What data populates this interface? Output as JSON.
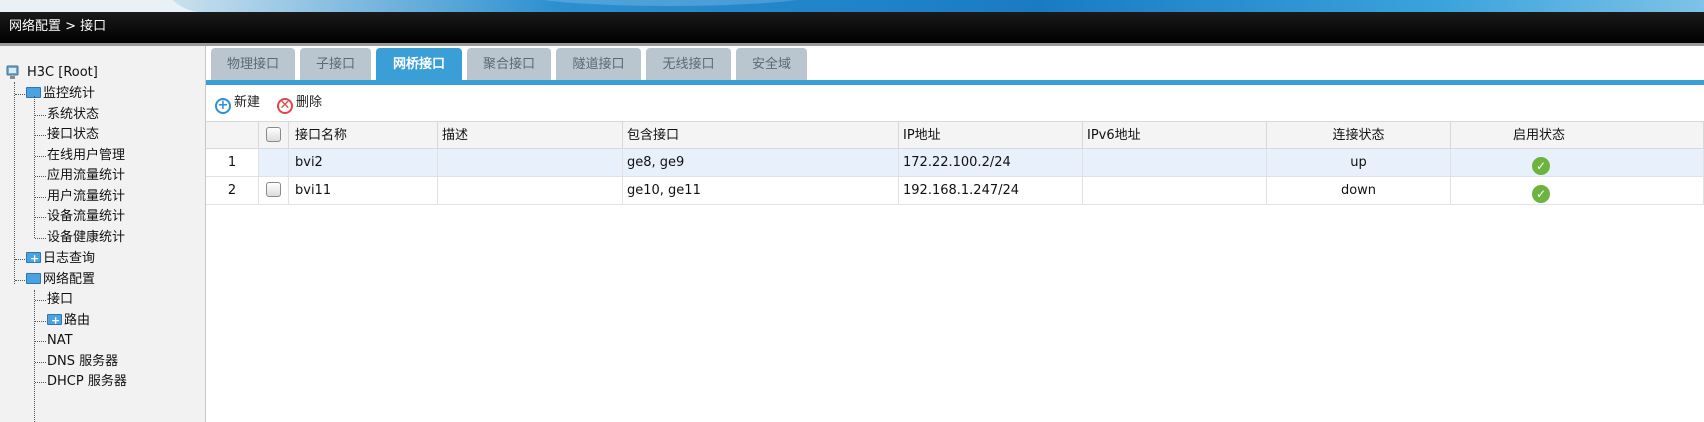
{
  "header": {
    "breadcrumb": "网络配置 > 接口"
  },
  "sidebar": {
    "root": "H3C [Root]",
    "groups": [
      {
        "label": "监控统计",
        "items": [
          "系统状态",
          "接口状态",
          "在线用户管理",
          "应用流量统计",
          "用户流量统计",
          "设备流量统计",
          "设备健康统计"
        ]
      },
      {
        "label": "日志查询"
      },
      {
        "label": "网络配置",
        "items": [
          "接口",
          "路由",
          "NAT",
          "DNS 服务器",
          "DHCP 服务器"
        ]
      }
    ]
  },
  "tabs": [
    "物理接口",
    "子接口",
    "网桥接口",
    "聚合接口",
    "隧道接口",
    "无线接口",
    "安全域"
  ],
  "active_tab": "网桥接口",
  "toolbar": {
    "new_label": "新建",
    "delete_label": "删除"
  },
  "table": {
    "columns": [
      "接口名称",
      "描述",
      "包含接口",
      "IP地址",
      "IPv6地址",
      "连接状态",
      "启用状态"
    ],
    "rows": [
      {
        "index": "1",
        "name": "bvi2",
        "desc": "",
        "members": "ge8, ge9",
        "ip": "172.22.100.2/24",
        "ipv6": "",
        "link": "up",
        "enabled": true
      },
      {
        "index": "2",
        "name": "bvi11",
        "desc": "",
        "members": "ge10, ge11",
        "ip": "192.168.1.247/24",
        "ipv6": "",
        "link": "down",
        "enabled": true
      }
    ]
  },
  "colors": {
    "accent": "#3a9fd6",
    "tab_inactive": "#b9c6cf",
    "status_ok": "#6cb33f"
  },
  "icons": {
    "new": "plus-circle-icon",
    "delete": "x-circle-icon",
    "enabled": "check-circle-icon"
  }
}
